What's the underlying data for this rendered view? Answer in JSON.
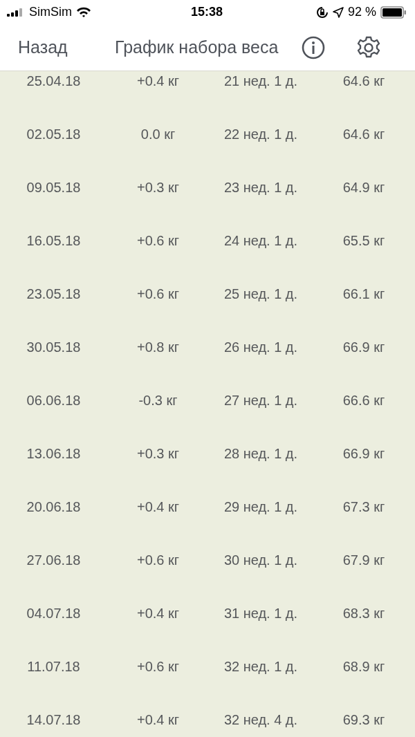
{
  "status_bar": {
    "carrier": "SimSim",
    "time": "15:38",
    "battery": "92 %"
  },
  "nav": {
    "back": "Назад",
    "title": "График набора веса"
  },
  "rows": [
    {
      "date": "25.04.18",
      "gain": "+0.4 кг",
      "week": "21 нед. 1 д.",
      "weight": "64.6 кг"
    },
    {
      "date": "02.05.18",
      "gain": "0.0 кг",
      "week": "22 нед. 1 д.",
      "weight": "64.6 кг"
    },
    {
      "date": "09.05.18",
      "gain": "+0.3 кг",
      "week": "23 нед. 1 д.",
      "weight": "64.9 кг"
    },
    {
      "date": "16.05.18",
      "gain": "+0.6 кг",
      "week": "24 нед. 1 д.",
      "weight": "65.5 кг"
    },
    {
      "date": "23.05.18",
      "gain": "+0.6 кг",
      "week": "25 нед. 1 д.",
      "weight": "66.1 кг"
    },
    {
      "date": "30.05.18",
      "gain": "+0.8 кг",
      "week": "26 нед. 1 д.",
      "weight": "66.9 кг"
    },
    {
      "date": "06.06.18",
      "gain": "-0.3 кг",
      "week": "27 нед. 1 д.",
      "weight": "66.6 кг"
    },
    {
      "date": "13.06.18",
      "gain": "+0.3 кг",
      "week": "28 нед. 1 д.",
      "weight": "66.9 кг"
    },
    {
      "date": "20.06.18",
      "gain": "+0.4 кг",
      "week": "29 нед. 1 д.",
      "weight": "67.3 кг"
    },
    {
      "date": "27.06.18",
      "gain": "+0.6 кг",
      "week": "30 нед. 1 д.",
      "weight": "67.9 кг"
    },
    {
      "date": "04.07.18",
      "gain": "+0.4 кг",
      "week": "31 нед. 1 д.",
      "weight": "68.3 кг"
    },
    {
      "date": "11.07.18",
      "gain": "+0.6 кг",
      "week": "32 нед. 1 д.",
      "weight": "68.9 кг"
    },
    {
      "date": "14.07.18",
      "gain": "+0.4 кг",
      "week": "32 нед. 4 д.",
      "weight": "69.3 кг"
    }
  ]
}
